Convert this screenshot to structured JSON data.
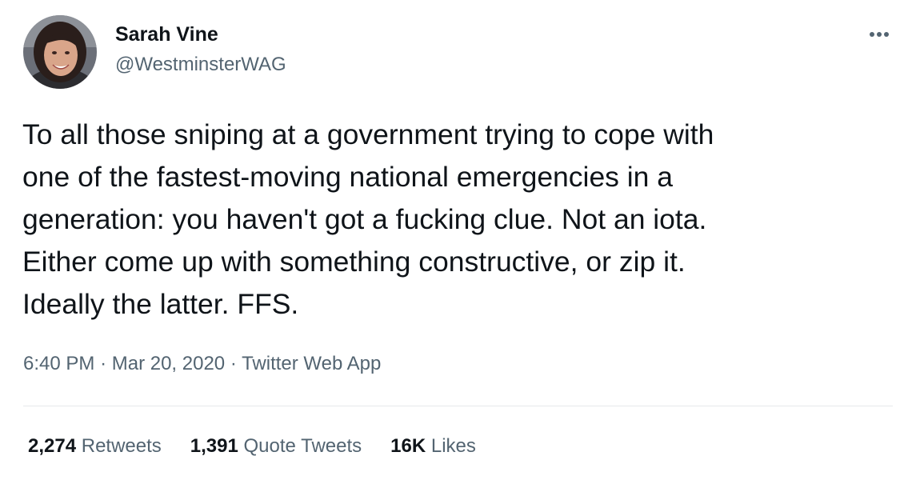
{
  "author": {
    "name": "Sarah Vine",
    "handle": "@WestminsterWAG"
  },
  "tweet": {
    "text": "To all those sniping at a government trying to cope with\none of the fastest-moving national emergencies in a\ngeneration: you haven't got a fucking clue. Not an iota.\nEither come up with something constructive, or zip it.\nIdeally the latter. FFS.",
    "time": "6:40 PM",
    "date": "Mar 20, 2020",
    "source": "Twitter Web App",
    "separator": "·"
  },
  "stats": {
    "retweets_count": "2,274",
    "retweets_label": "Retweets",
    "quotes_count": "1,391",
    "quotes_label": "Quote Tweets",
    "likes_count": "16K",
    "likes_label": "Likes"
  },
  "icons": {
    "more": "more-horizontal-icon",
    "avatar": "profile-photo"
  },
  "colors": {
    "text_primary": "#0f1419",
    "text_secondary": "#536471",
    "divider": "#e7e9ea",
    "background": "#ffffff"
  }
}
